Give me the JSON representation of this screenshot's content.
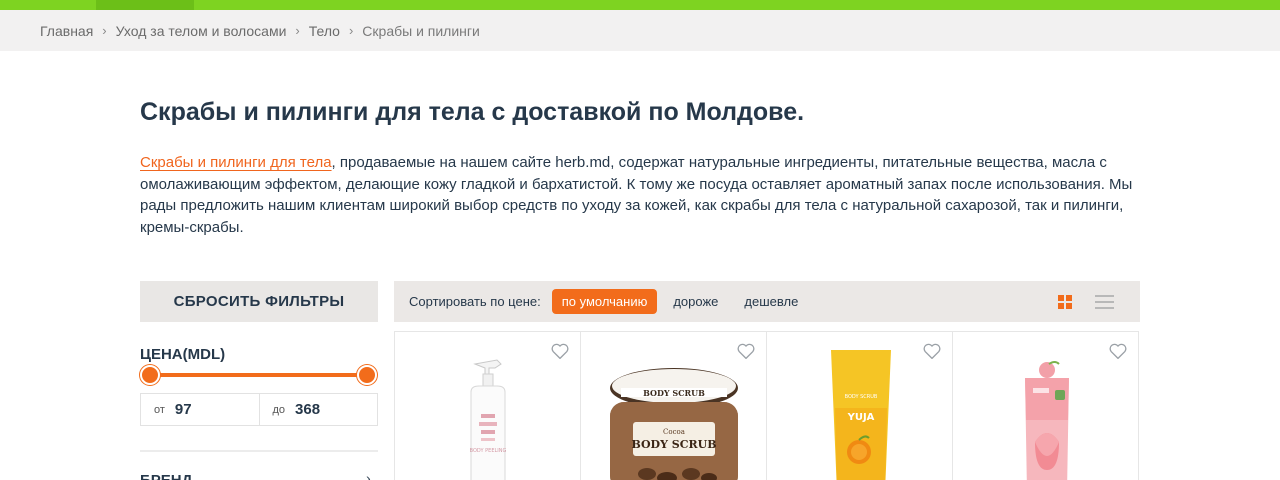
{
  "breadcrumbs": [
    {
      "label": "Главная"
    },
    {
      "label": "Уход за телом и волосами"
    },
    {
      "label": "Тело"
    },
    {
      "label": "Скрабы и пилинги"
    }
  ],
  "page": {
    "title": "Скрабы и пилинги для тела с доставкой по Молдове.",
    "description_link": "Скрабы и пилинги для тела",
    "description_text": ", продаваемые на нашем сайте herb.md, содержат натуральные ингредиенты, питательные вещества, масла с омолаживающим эффектом, делающие кожу гладкой и бархатистой. К тому же посуда оставляет ароматный запах после использования. Мы рады предложить нашим клиентам широкий выбор средств по уходу за кожей, как скрабы для тела с натуральной сахарозой, так и пилинги, кремы-скрабы."
  },
  "filters": {
    "reset_label": "СБРОСИТЬ ФИЛЬТРЫ",
    "price_title": "ЦЕНА(MDL)",
    "from_prefix": "от",
    "from_value": "97",
    "to_prefix": "до",
    "to_value": "368",
    "brand_title": "БРЕНД"
  },
  "sort": {
    "label": "Сортировать по цене:",
    "options": [
      "по умолчанию",
      "дороже",
      "дешевле"
    ],
    "active_index": 0
  },
  "products": [
    {
      "image_icon": "spray-bottle-icon",
      "image_text": "BODY PEELING"
    },
    {
      "image_icon": "scrub-jar-icon",
      "image_text": "BODY SCRUB",
      "image_text2": "Cocoa"
    },
    {
      "image_icon": "tube-icon",
      "image_text": "YUJA",
      "image_text2": "BODY SCRUB"
    },
    {
      "image_icon": "pink-tube-icon",
      "image_text": ""
    }
  ],
  "colors": {
    "accent": "#f26c1b",
    "top_bar": "#7ed321",
    "text": "#26384a"
  }
}
